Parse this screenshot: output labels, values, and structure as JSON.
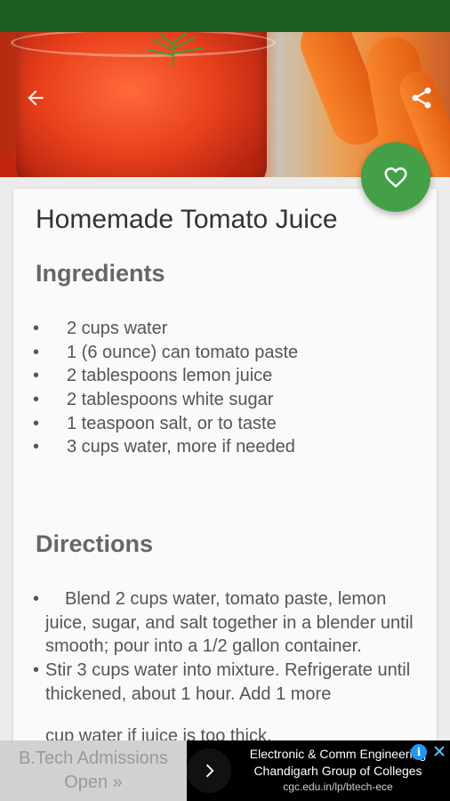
{
  "recipe": {
    "title": "Homemade Tomato Juice",
    "ingredients_heading": "Ingredients",
    "ingredients": [
      "2 cups water",
      "1 (6 ounce) can tomato paste",
      "2 tablespoons lemon juice",
      "2 tablespoons white sugar",
      "1 teaspoon salt, or to taste",
      "3 cups water, more if needed"
    ],
    "directions_heading": "Directions",
    "directions": [
      "Blend 2 cups water, tomato paste, lemon juice, sugar, and salt together in a blender until smooth; pour into a 1/2 gallon container.",
      "Stir 3 cups water into mixture. Refrigerate until thickened, about 1 hour. Add 1 more"
    ],
    "directions_cut_line": "cup water if juice is too thick.",
    "bullet": "•"
  },
  "toolbar": {
    "back_icon": "arrow-back-icon",
    "share_icon": "share-icon",
    "favorite_icon": "heart-outline-icon"
  },
  "ad": {
    "left_line1": "B.Tech Admissions",
    "left_line2": "Open »",
    "line1": "Electronic & Comm Engineering",
    "line2": "Chandigarh Group of Colleges",
    "url": "cgc.edu.in/lp/btech-ece",
    "info_glyph": "i"
  },
  "colors": {
    "status_bar": "#1b5e20",
    "fab": "#43a047",
    "heading": "#666666",
    "body_text": "#555555"
  }
}
